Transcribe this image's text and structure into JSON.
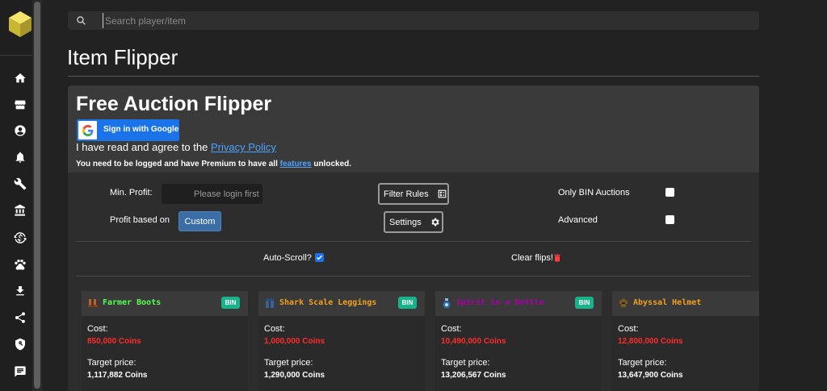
{
  "search": {
    "placeholder": "Search player/item"
  },
  "page": {
    "title": "Item Flipper"
  },
  "sidebar": {
    "items": [
      {
        "name": "home-icon"
      },
      {
        "name": "store-icon"
      },
      {
        "name": "account-icon"
      },
      {
        "name": "notifications-icon"
      },
      {
        "name": "wrench-icon"
      },
      {
        "name": "bank-icon"
      },
      {
        "name": "currency-exchange-icon"
      },
      {
        "name": "paw-icon"
      },
      {
        "name": "download-icon"
      },
      {
        "name": "share-icon"
      },
      {
        "name": "privacy-shield-icon"
      },
      {
        "name": "chat-icon"
      }
    ]
  },
  "flipper": {
    "title": "Free Auction Flipper",
    "google_button": "Sign in with Google",
    "agree_prefix": "I have read and agree to the ",
    "privacy_link": "Privacy Policy",
    "premium_prefix": "You need to be logged and have Premium to have all ",
    "features_link": "features",
    "premium_suffix": " unlocked.",
    "min_profit_label": "Min. Profit:",
    "min_profit_placeholder": "Please login first",
    "profit_based_label": "Profit based on",
    "profit_based_value": "Custom",
    "filter_rules_button": "Filter Rules",
    "settings_button": "Settings",
    "only_bin_label": "Only BIN Auctions",
    "only_bin_checked": false,
    "advanced_label": "Advanced",
    "advanced_checked": false,
    "auto_scroll_label": "Auto-Scroll?",
    "auto_scroll_checked": true,
    "clear_flips_label": "Clear flips!"
  },
  "flips": [
    {
      "name": "Farmer Boots",
      "name_color": "#55ff55",
      "bin": "BIN",
      "cost_label": "Cost:",
      "cost": "850,000 Coins",
      "target_label": "Target price:",
      "target": "1,117,882 Coins",
      "icon": "boots-icon"
    },
    {
      "name": "Shark Scale Leggings",
      "name_color": "#f0a020",
      "bin": "BIN",
      "cost_label": "Cost:",
      "cost": "1,000,000 Coins",
      "target_label": "Target price:",
      "target": "1,290,000 Coins",
      "icon": "leggings-icon"
    },
    {
      "name": "Spirit in a Bottle",
      "name_color": "#aa00aa",
      "bin": "BIN",
      "cost_label": "Cost:",
      "cost": "10,490,000 Coins",
      "target_label": "Target price:",
      "target": "13,206,567 Coins",
      "icon": "bottle-icon"
    },
    {
      "name": "Abyssal Helmet",
      "name_color": "#f0a020",
      "bin": "",
      "cost_label": "Cost:",
      "cost": "12,800,000 Coins",
      "target_label": "Target price:",
      "target": "13,647,900 Coins",
      "icon": "helmet-icon"
    }
  ],
  "colors": {
    "accent": "#1a73e8",
    "bin_badge": "#18b38a",
    "cost": "#ff2a2a",
    "custom_button": "#3b6ea5"
  }
}
